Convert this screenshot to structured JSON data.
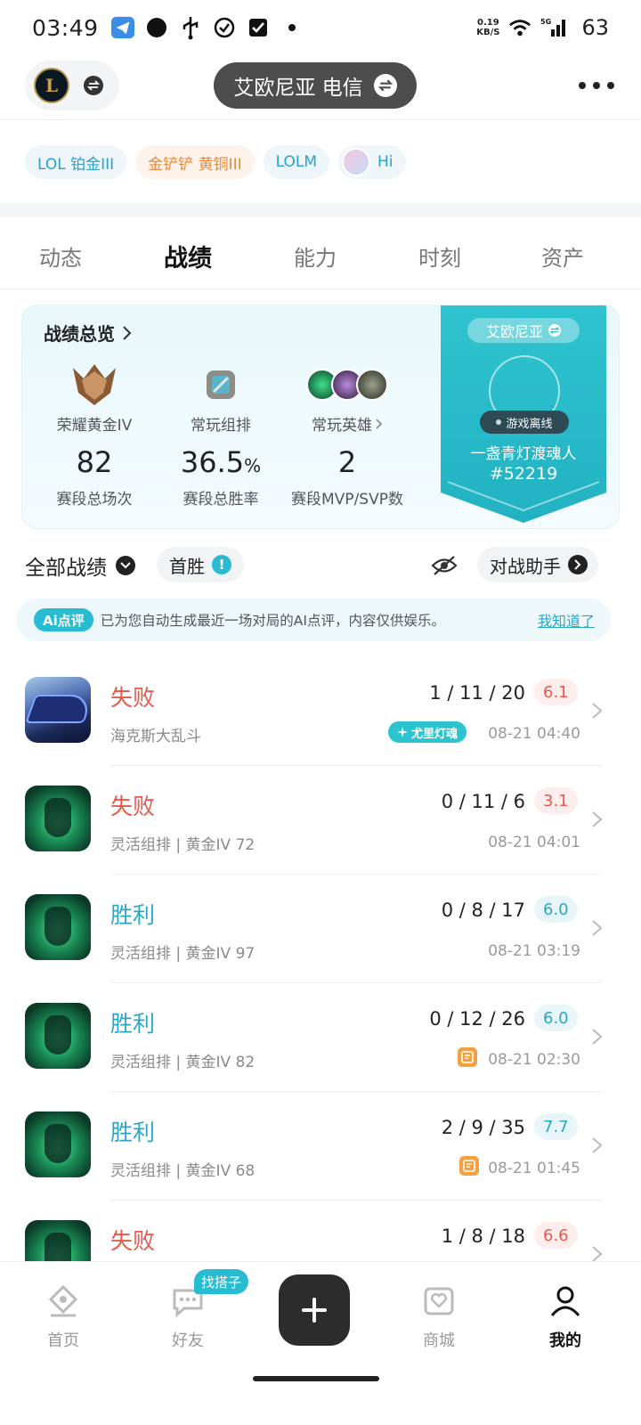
{
  "status_bar": {
    "time": "03:49",
    "speed_value": "0.19",
    "speed_unit": "KB/S",
    "network": "5G",
    "battery": "63",
    "icons": [
      "telegram-icon",
      "circle-icon",
      "usb-icon",
      "check-circle-icon",
      "check-box-icon",
      "dot-icon",
      "wifi-icon",
      "signal-icon"
    ]
  },
  "header": {
    "server_label": "艾欧尼亚  电信",
    "logo_letter": "L"
  },
  "tags": [
    {
      "label": "LOL 铂金III"
    },
    {
      "label": "金铲铲 黄铜III"
    },
    {
      "label": "LOLM"
    },
    {
      "label": "Hi"
    }
  ],
  "tabs": [
    {
      "label": "动态"
    },
    {
      "label": "战绩"
    },
    {
      "label": "能力"
    },
    {
      "label": "时刻"
    },
    {
      "label": "资产"
    }
  ],
  "overview": {
    "title": "战绩总览",
    "rank_label": "荣耀黄金IV",
    "rank_value": "82",
    "rank_sub": "赛段总场次",
    "mode_label": "常玩组排",
    "mode_value": "36.5",
    "mode_unit": "%",
    "mode_sub": "赛段总胜率",
    "hero_label": "常玩英雄",
    "hero_value": "2",
    "hero_sub": "赛段MVP/SVP数",
    "banner_server": "艾欧尼亚",
    "banner_status": "游戏离线",
    "banner_name": "一盏青灯渡魂人",
    "banner_tag": "#52219"
  },
  "filters": {
    "all_label": "全部战绩",
    "first_win_label": "首胜",
    "first_win_badge": "!",
    "assistant_label": "对战助手"
  },
  "ai_tip": {
    "badge": "Ai点评",
    "text": "已为您自动生成最近一场对局的AI点评，内容仅供娱乐。",
    "link": "我知道了"
  },
  "matches": [
    {
      "result": "失败",
      "mode": "海克斯大乱斗",
      "kda": "1 / 11 / 20",
      "score": "6.1",
      "time": "08-21 04:40",
      "badge": "尤里灯魂"
    },
    {
      "result": "失败",
      "mode": "灵活组排 | 黄金IV 72",
      "kda": "0 / 11 / 6",
      "score": "3.1",
      "time": "08-21 04:01"
    },
    {
      "result": "胜利",
      "mode": "灵活组排 | 黄金IV 97",
      "kda": "0 / 8 / 17",
      "score": "6.0",
      "time": "08-21 03:19"
    },
    {
      "result": "胜利",
      "mode": "灵活组排 | 黄金IV 82",
      "kda": "0 / 12 / 26",
      "score": "6.0",
      "time": "08-21 02:30"
    },
    {
      "result": "胜利",
      "mode": "灵活组排 | 黄金IV 68",
      "kda": "2 / 9 / 35",
      "score": "7.7",
      "time": "08-21 01:45"
    },
    {
      "result": "失败",
      "mode": "",
      "kda": "1 / 8 / 18",
      "score": "6.6",
      "time": ""
    }
  ],
  "bottom_nav": {
    "home": "首页",
    "friends": "好友",
    "friends_badge": "找搭子",
    "shop": "商城",
    "me": "我的"
  },
  "colors": {
    "accent": "#27bcd1",
    "lose": "#e55a4a",
    "win": "#2aa6c6",
    "banner": "#2cc0cc"
  }
}
